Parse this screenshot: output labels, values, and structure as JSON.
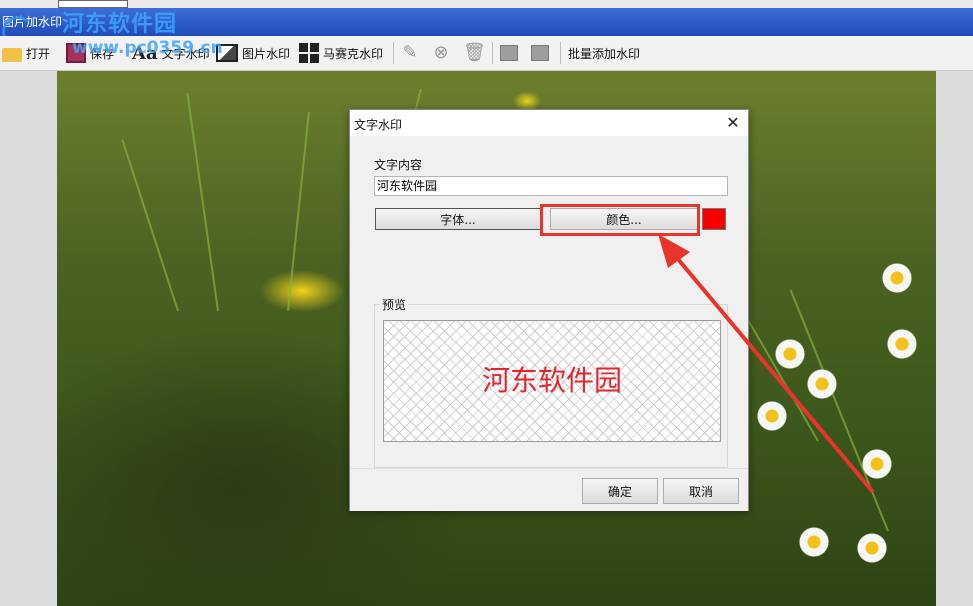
{
  "window": {
    "title": "图片加水印",
    "watermark_logo": "河东软件园",
    "watermark_site": "www.pc0359.cn"
  },
  "toolbar": {
    "items": [
      {
        "label": "打开",
        "icon": "folder-icon"
      },
      {
        "label": "保存",
        "icon": "save-icon"
      },
      {
        "label": "文字水印",
        "icon": "text-icon"
      },
      {
        "label": "图片水印",
        "icon": "image-icon"
      },
      {
        "label": "马赛克水印",
        "icon": "mosaic-icon"
      },
      {
        "label": "",
        "icon": "pencil-icon"
      },
      {
        "label": "",
        "icon": "remove-icon"
      },
      {
        "label": "",
        "icon": "trash-icon"
      },
      {
        "label": "",
        "icon": "layer-front-icon"
      },
      {
        "label": "",
        "icon": "layer-back-icon"
      },
      {
        "label": "批量添加水印",
        "icon": ""
      }
    ]
  },
  "dialog": {
    "title": "文字水印",
    "close_symbol": "✕",
    "text_content_label": "文字内容",
    "text_content_value": "河东软件园",
    "font_button": "字体...",
    "color_button": "颜色...",
    "color_value": "#f80000",
    "preview_label": "预览",
    "preview_text": "河东软件园",
    "ok_button": "确定",
    "cancel_button": "取消"
  },
  "annotation": {
    "highlight_color": "#e8342a"
  }
}
